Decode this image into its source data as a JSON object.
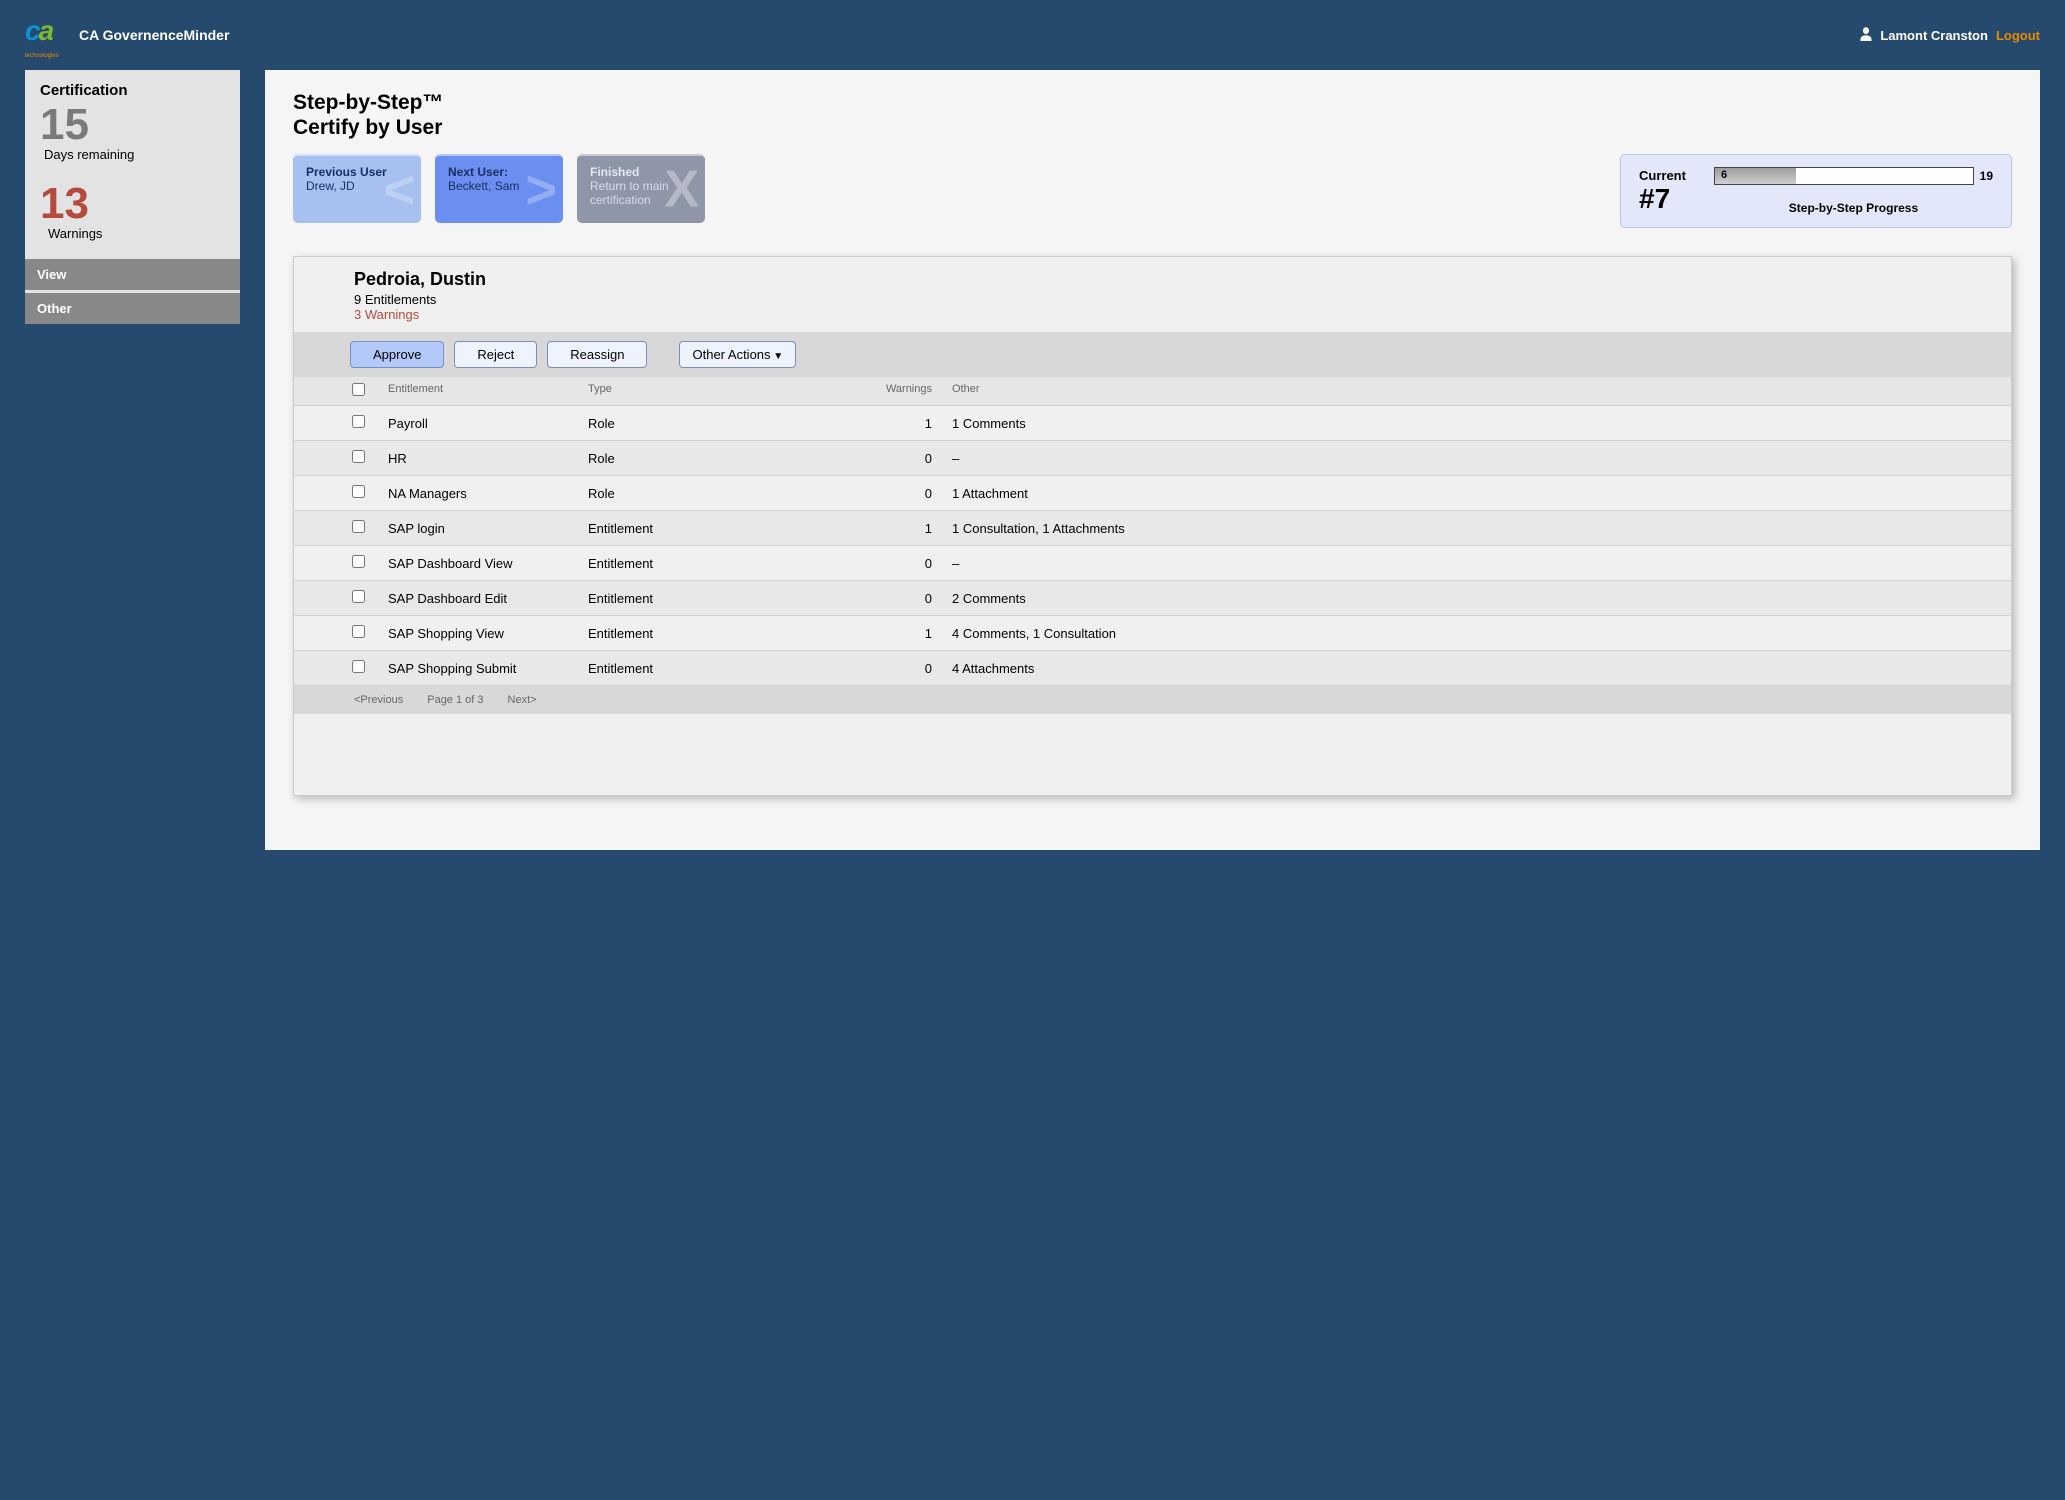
{
  "header": {
    "app_title": "CA GovernenceMinder",
    "logo_sub": "technologies",
    "username": "Lamont Cranston",
    "logout_label": "Logout"
  },
  "sidebar": {
    "cert_title": "Certification",
    "days_num": "15",
    "days_label": "Days remaining",
    "warn_num": "13",
    "warn_label": "Warnings",
    "tabs": [
      "View",
      "Other"
    ]
  },
  "page": {
    "title_line1": "Step-by-Step™",
    "title_line2": "Certify by User"
  },
  "nav": {
    "prev_title": "Previous User",
    "prev_name": "Drew, JD",
    "next_title": "Next User:",
    "next_name": "Beckett, Sam",
    "fin_title": "Finished",
    "fin_sub": "Return to main certification"
  },
  "progress": {
    "current_label": "Current",
    "current_num": "#7",
    "done": "6",
    "total": "19",
    "label": "Step-by-Step Progress"
  },
  "user": {
    "name": "Pedroia, Dustin",
    "entitlements": "9 Entitlements",
    "warnings": "3 Warnings"
  },
  "actions": {
    "approve": "Approve",
    "reject": "Reject",
    "reassign": "Reassign",
    "other": "Other Actions"
  },
  "columns": {
    "entitlement": "Entitlement",
    "type": "Type",
    "warnings": "Warnings",
    "other": "Other"
  },
  "rows": [
    {
      "ent": "Payroll",
      "type": "Role",
      "warn": "1",
      "other": "1 Comments"
    },
    {
      "ent": "HR",
      "type": "Role",
      "warn": "0",
      "other": "–"
    },
    {
      "ent": "NA Managers",
      "type": "Role",
      "warn": "0",
      "other": "1 Attachment"
    },
    {
      "ent": "SAP login",
      "type": "Entitlement",
      "warn": "1",
      "other": "1 Consultation, 1 Attachments"
    },
    {
      "ent": "SAP Dashboard View",
      "type": "Entitlement",
      "warn": "0",
      "other": "–"
    },
    {
      "ent": "SAP Dashboard Edit",
      "type": "Entitlement",
      "warn": "0",
      "other": "2 Comments"
    },
    {
      "ent": "SAP Shopping View",
      "type": "Entitlement",
      "warn": "1",
      "other": "4 Comments, 1 Consultation"
    },
    {
      "ent": "SAP Shopping Submit",
      "type": "Entitlement",
      "warn": "0",
      "other": "4 Attachments"
    }
  ],
  "footer": {
    "prev": "<Previous",
    "page": "Page 1 of 3",
    "next": "Next>"
  }
}
